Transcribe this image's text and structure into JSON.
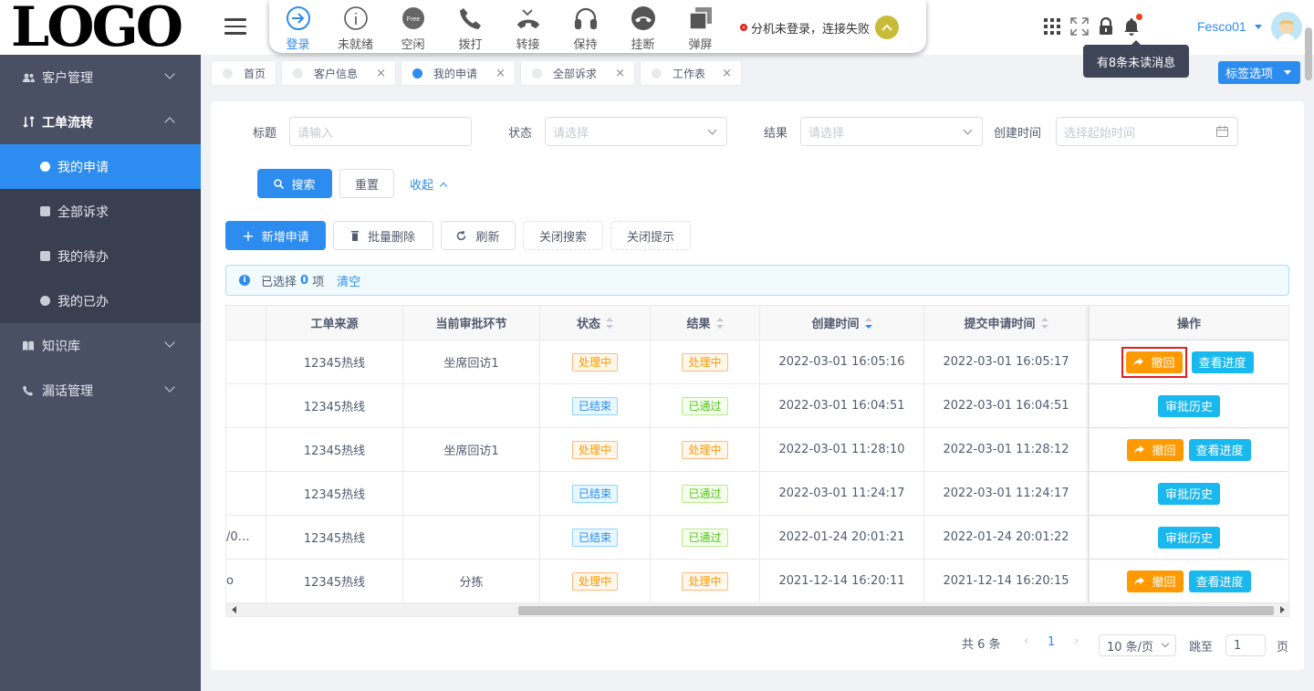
{
  "logo": "LOGO",
  "sidebar": {
    "items": [
      {
        "label": "客户管理",
        "icon": "users-icon",
        "open": false
      },
      {
        "label": "工单流转",
        "icon": "workflow-icon",
        "open": true
      },
      {
        "label": "知识库",
        "icon": "book-icon",
        "open": false
      },
      {
        "label": "漏话管理",
        "icon": "phone-icon",
        "open": false
      }
    ],
    "sub_items": [
      {
        "label": "我的申请",
        "active": true
      },
      {
        "label": "全部诉求",
        "active": false
      },
      {
        "label": "我的待办",
        "active": false
      },
      {
        "label": "我的已办",
        "active": false
      }
    ]
  },
  "phonebar": {
    "buttons": [
      {
        "label": "登录",
        "icon": "login-icon"
      },
      {
        "label": "未就绪",
        "icon": "info-icon"
      },
      {
        "label": "空闲",
        "icon": "free-icon",
        "badge": "Free"
      },
      {
        "label": "拨打",
        "icon": "phone-icon"
      },
      {
        "label": "转接",
        "icon": "transfer-icon"
      },
      {
        "label": "保持",
        "icon": "headset-icon"
      },
      {
        "label": "挂断",
        "icon": "hangup-icon"
      },
      {
        "label": "弹屏",
        "icon": "popup-icon"
      }
    ],
    "status": "分机未登录，连接失败"
  },
  "header": {
    "user": "Fesco01",
    "tooltip": "有8条未读消息"
  },
  "tabs": [
    {
      "label": "首页",
      "closable": false,
      "active": false
    },
    {
      "label": "客户信息",
      "closable": true,
      "active": false
    },
    {
      "label": "我的申请",
      "closable": true,
      "active": true
    },
    {
      "label": "全部诉求",
      "closable": true,
      "active": false
    },
    {
      "label": "工作表",
      "closable": true,
      "active": false
    }
  ],
  "tab_options": "标签选项",
  "filters": {
    "title_label": "标题",
    "title_placeholder": "请输入",
    "status_label": "状态",
    "status_placeholder": "请选择",
    "result_label": "结果",
    "result_placeholder": "请选择",
    "created_label": "创建时间",
    "created_placeholder": "选择起始时间",
    "search": "搜索",
    "reset": "重置",
    "collapse": "收起"
  },
  "toolbar": {
    "add": "新增申请",
    "batch_delete": "批量删除",
    "refresh": "刷新",
    "close_search": "关闭搜索",
    "close_tips": "关闭提示"
  },
  "alert": {
    "prefix": "已选择",
    "count": "0",
    "suffix": "项",
    "clear": "清空"
  },
  "table": {
    "columns": [
      "工单来源",
      "当前审批环节",
      "状态",
      "结果",
      "创建时间",
      "提交申请时间",
      "操作"
    ],
    "rows": [
      {
        "first": "",
        "source": "12345热线",
        "step": "坐席回访1",
        "status": "处理中",
        "result": "处理中",
        "created": "2022-03-01 16:05:16",
        "submitted": "2022-03-01 16:05:17",
        "actions": [
          "撤回",
          "查看进度"
        ],
        "highlight": true
      },
      {
        "first": "",
        "source": "12345热线",
        "step": "",
        "status": "已结束",
        "result": "已通过",
        "created": "2022-03-01 16:04:51",
        "submitted": "2022-03-01 16:04:51",
        "actions": [
          "审批历史"
        ]
      },
      {
        "first": "",
        "source": "12345热线",
        "step": "坐席回访1",
        "status": "处理中",
        "result": "处理中",
        "created": "2022-03-01 11:28:10",
        "submitted": "2022-03-01 11:28:12",
        "actions": [
          "撤回",
          "查看进度"
        ]
      },
      {
        "first": "",
        "source": "12345热线",
        "step": "",
        "status": "已结束",
        "result": "已通过",
        "created": "2022-03-01 11:24:17",
        "submitted": "2022-03-01 11:24:17",
        "actions": [
          "审批历史"
        ]
      },
      {
        "first": "/0…",
        "source": "12345热线",
        "step": "",
        "status": "已结束",
        "result": "已通过",
        "created": "2022-01-24 20:01:21",
        "submitted": "2022-01-24 20:01:22",
        "actions": [
          "审批历史"
        ]
      },
      {
        "first": "o",
        "source": "12345热线",
        "step": "分拣",
        "status": "处理中",
        "result": "处理中",
        "created": "2021-12-14 16:20:11",
        "submitted": "2021-12-14 16:20:15",
        "actions": [
          "撤回",
          "查看进度"
        ]
      }
    ]
  },
  "pager": {
    "total": "共 6 条",
    "page": "1",
    "page_size": "10 条/页",
    "goto": "跳至",
    "goto_value": "1",
    "page_unit": "页"
  },
  "colors": {
    "primary": "#2d8cf0",
    "warning": "#ff9900",
    "info": "#19b8ef",
    "highlight_border": "#e02020"
  }
}
